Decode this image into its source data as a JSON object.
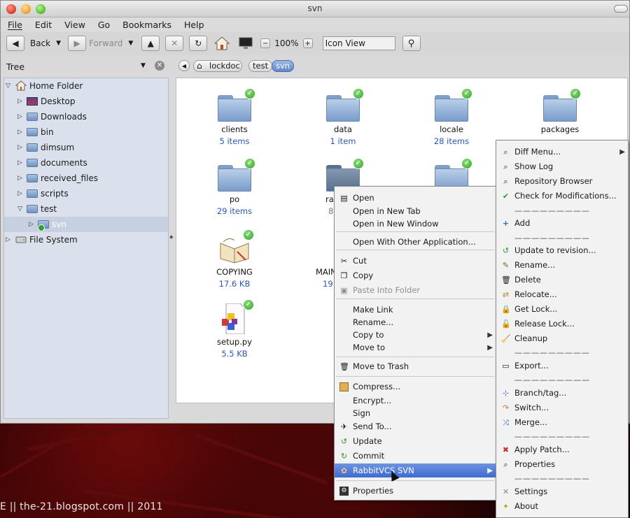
{
  "window": {
    "title": "svn"
  },
  "menubar": [
    "File",
    "Edit",
    "View",
    "Go",
    "Bookmarks",
    "Help"
  ],
  "toolbar": {
    "back": "Back",
    "forward": "Forward",
    "zoom": "100%",
    "view_mode": "Icon View"
  },
  "sidebar_mode": "Tree",
  "breadcrumbs": [
    "lockdoc",
    "test",
    "svn"
  ],
  "tree": [
    {
      "label": "Home Folder",
      "level": 0,
      "expanded": true
    },
    {
      "label": "Desktop",
      "level": 1
    },
    {
      "label": "Downloads",
      "level": 1
    },
    {
      "label": "bin",
      "level": 1
    },
    {
      "label": "dimsum",
      "level": 1
    },
    {
      "label": "documents",
      "level": 1
    },
    {
      "label": "received_files",
      "level": 1
    },
    {
      "label": "scripts",
      "level": 1
    },
    {
      "label": "test",
      "level": 1,
      "expanded": true
    },
    {
      "label": "svn",
      "level": 2,
      "selected": true
    },
    {
      "label": "File System",
      "level": 0
    }
  ],
  "files": [
    {
      "name": "clients",
      "info": "5 items",
      "kind": "folder"
    },
    {
      "name": "data",
      "info": "1 item",
      "kind": "folder"
    },
    {
      "name": "locale",
      "info": "28 items",
      "kind": "folder"
    },
    {
      "name": "packages",
      "info": "",
      "kind": "folder"
    },
    {
      "name": "po",
      "info": "29 items",
      "kind": "folder"
    },
    {
      "name": "ra",
      "info": "8",
      "kind": "folder-selected"
    },
    {
      "name": "",
      "info": "",
      "kind": "folder"
    },
    {
      "name": "COPYING",
      "info": "17.6 KB",
      "kind": "book"
    },
    {
      "name": "MAIN",
      "info": "19",
      "kind": "doc"
    },
    {
      "name": "setup.py",
      "info": "5.5 KB",
      "kind": "script"
    }
  ],
  "context_menu": [
    {
      "label": "Open",
      "icon": "open-icon"
    },
    {
      "label": "Open in New Tab"
    },
    {
      "label": "Open in New Window"
    },
    {
      "sep": true
    },
    {
      "label": "Open With Other Application..."
    },
    {
      "sep": true
    },
    {
      "label": "Cut",
      "icon": "cut-icon"
    },
    {
      "label": "Copy",
      "icon": "copy-icon"
    },
    {
      "label": "Paste Into Folder",
      "icon": "paste-icon",
      "disabled": true
    },
    {
      "sep": true
    },
    {
      "label": "Make Link"
    },
    {
      "label": "Rename..."
    },
    {
      "label": "Copy to",
      "submenu": true
    },
    {
      "label": "Move to",
      "submenu": true
    },
    {
      "sep": true
    },
    {
      "label": "Move to Trash",
      "icon": "trash-icon"
    },
    {
      "sep": true
    },
    {
      "label": "Compress...",
      "icon": "archive-icon"
    },
    {
      "label": "Encrypt..."
    },
    {
      "label": "Sign"
    },
    {
      "label": "Send To...",
      "icon": "send-icon"
    },
    {
      "label": "Update",
      "icon": "update-icon"
    },
    {
      "label": "Commit",
      "icon": "commit-icon"
    },
    {
      "label": "RabbitVCS SVN",
      "icon": "rabbitvcs-icon",
      "submenu": true,
      "highlighted": true
    },
    {
      "sep": true
    },
    {
      "label": "Properties",
      "icon": "properties-icon"
    }
  ],
  "svn_submenu": [
    {
      "label": "Diff Menu...",
      "icon": "diff-icon",
      "submenu": true
    },
    {
      "label": "Show Log",
      "icon": "log-icon"
    },
    {
      "label": "Repository Browser",
      "icon": "repo-icon"
    },
    {
      "label": "Check for Modifications...",
      "icon": "check-icon"
    },
    {
      "dash": "—————————"
    },
    {
      "label": "Add",
      "icon": "add-icon"
    },
    {
      "dash": "—————————"
    },
    {
      "label": "Update to revision...",
      "icon": "update-icon"
    },
    {
      "label": "Rename...",
      "icon": "rename-icon"
    },
    {
      "label": "Delete",
      "icon": "delete-icon"
    },
    {
      "label": "Relocate...",
      "icon": "relocate-icon"
    },
    {
      "label": "Get Lock...",
      "icon": "lock-icon"
    },
    {
      "label": "Release Lock...",
      "icon": "unlock-icon"
    },
    {
      "label": "Cleanup",
      "icon": "cleanup-icon"
    },
    {
      "dash": "—————————"
    },
    {
      "label": "Export...",
      "icon": "export-icon"
    },
    {
      "dash": "—————————"
    },
    {
      "label": "Branch/tag...",
      "icon": "branch-icon"
    },
    {
      "label": "Switch...",
      "icon": "switch-icon"
    },
    {
      "label": "Merge...",
      "icon": "merge-icon"
    },
    {
      "dash": "—————————"
    },
    {
      "label": "Apply Patch...",
      "icon": "patch-icon"
    },
    {
      "label": "Properties",
      "icon": "properties-icon"
    },
    {
      "dash": "—————————"
    },
    {
      "label": "Settings",
      "icon": "settings-icon"
    },
    {
      "label": "About",
      "icon": "about-icon"
    }
  ],
  "footer": "E || the-21.blogspot.com || 2011"
}
